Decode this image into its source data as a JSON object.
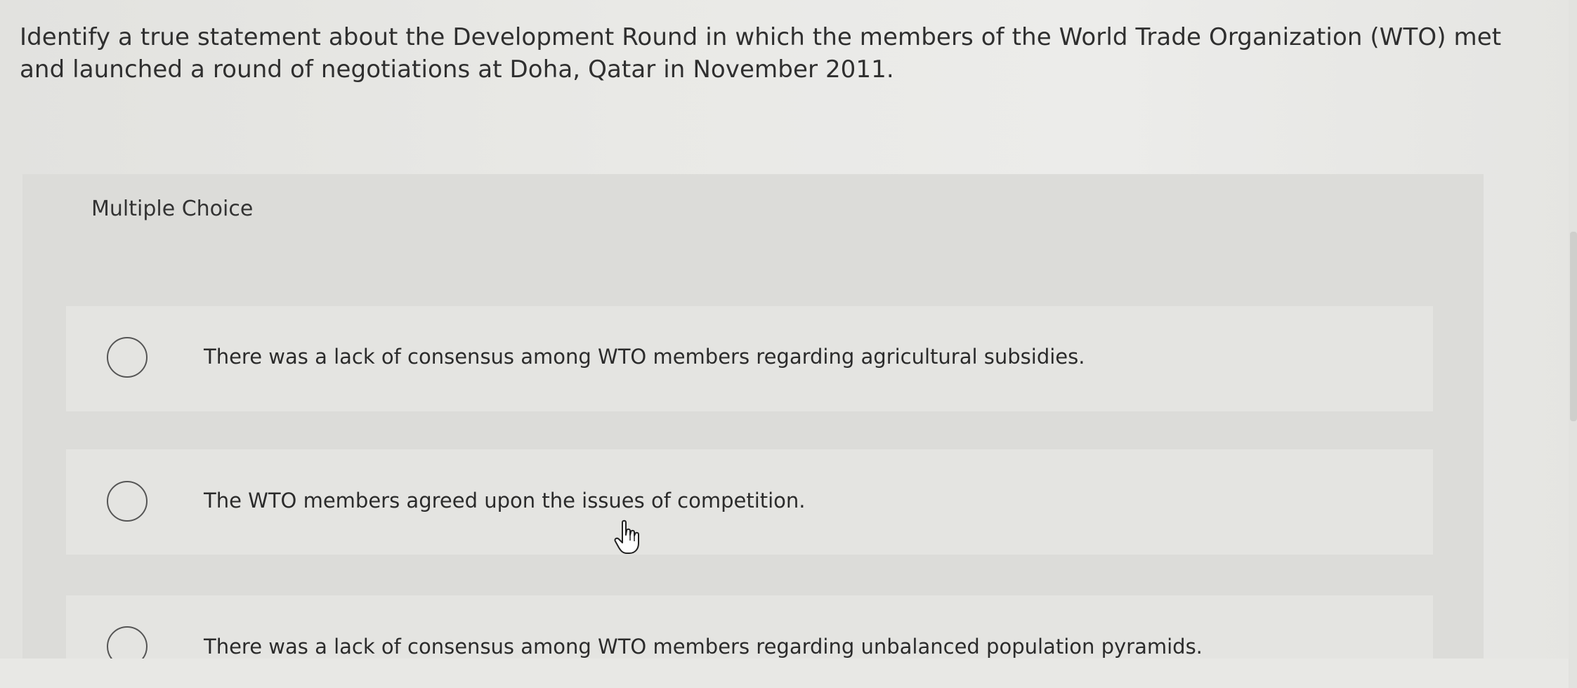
{
  "question": {
    "text": "Identify a true statement about the Development Round in which the members of the World Trade Organization (WTO) met and launched a round of negotiations at Doha, Qatar in November 2011."
  },
  "multiple_choice": {
    "header": "Multiple Choice",
    "options": [
      {
        "label": "There was a lack of consensus among WTO members regarding agricultural subsidies.",
        "selected": false
      },
      {
        "label": "The WTO members agreed upon the issues of competition.",
        "selected": false
      },
      {
        "label": "There was a lack of consensus among WTO members regarding unbalanced population pyramids.",
        "selected": false
      }
    ]
  },
  "cursor": {
    "icon": "hand-pointer-icon"
  }
}
